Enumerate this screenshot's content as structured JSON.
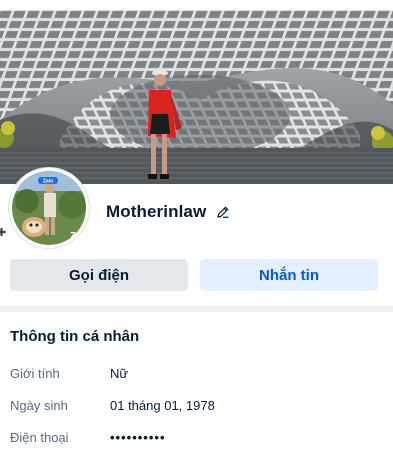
{
  "profile": {
    "name": "Motherinlaw",
    "avatar_badge": "Zalo"
  },
  "actions": {
    "call_label": "Gọi điện",
    "message_label": "Nhắn tin"
  },
  "info": {
    "title": "Thông tin cá nhân",
    "rows": [
      {
        "label": "Giới tính",
        "value": "Nữ"
      },
      {
        "label": "Ngày sinh",
        "value": "01 tháng 01, 1978"
      },
      {
        "label": "Điện thoại",
        "value": "••••••••••"
      }
    ]
  },
  "icons": {
    "edit": "pencil-icon"
  },
  "colors": {
    "primary": "#005ae0",
    "primary_bg": "#e5efff",
    "secondary_bg": "#e4e7ec",
    "text": "#081c36",
    "label": "#5a6981"
  }
}
